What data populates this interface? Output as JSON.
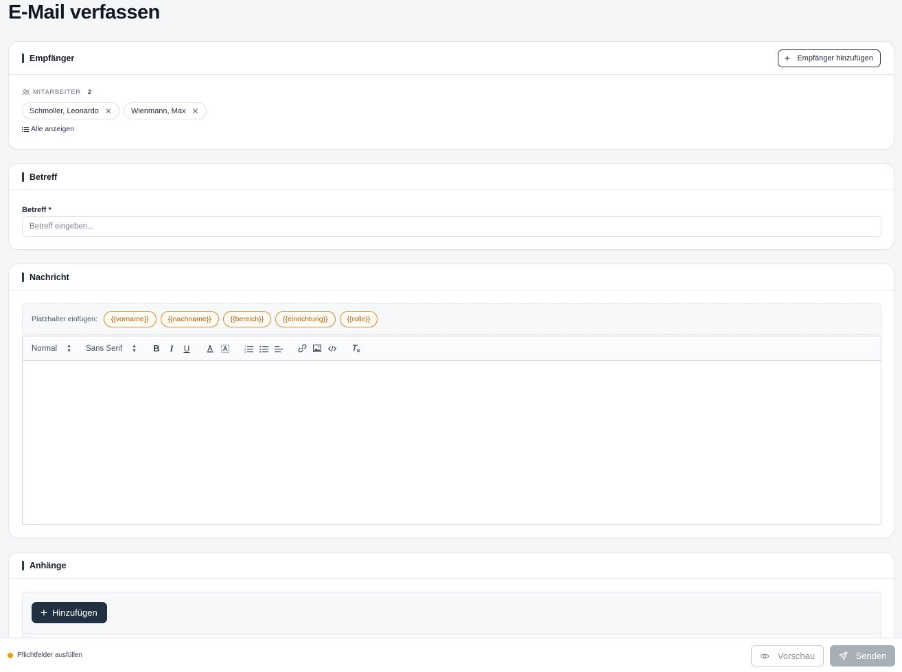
{
  "page": {
    "title": "E-Mail verfassen"
  },
  "recipients": {
    "title": "Empfänger",
    "add_button": "Empfänger hinzufügen",
    "group_label": "MITARBEITER",
    "group_count": "2",
    "chips": [
      "Schmoller, Leonardo",
      "Wienmann, Max"
    ],
    "show_all": "Alle anzeigen"
  },
  "subject": {
    "title": "Betreff",
    "label": "Betreff *",
    "placeholder": "Betreff eingeben...",
    "value": ""
  },
  "message": {
    "title": "Nachricht",
    "placeholder_label": "Platzhalter einfügen:",
    "placeholders": [
      "{{vorname}}",
      "{{nachname}}",
      "{{bereich}}",
      "{{einrichtung}}",
      "{{rolle}}"
    ],
    "toolbar": {
      "size": "Normal",
      "font": "Sans Serif",
      "icons": [
        "bold-icon",
        "italic-icon",
        "underline-icon",
        "font-color-icon",
        "background-color-icon",
        "ordered-list-icon",
        "bullet-list-icon",
        "align-icon",
        "link-icon",
        "image-icon",
        "code-icon",
        "clear-format-icon"
      ]
    },
    "body": ""
  },
  "attachments": {
    "title": "Anhänge",
    "add_button": "Hinzufügen"
  },
  "footer": {
    "status": "Pflichtfelder ausfüllen",
    "status_color": "#e6a11a",
    "preview_button": "Vorschau",
    "send_button": "Senden"
  }
}
